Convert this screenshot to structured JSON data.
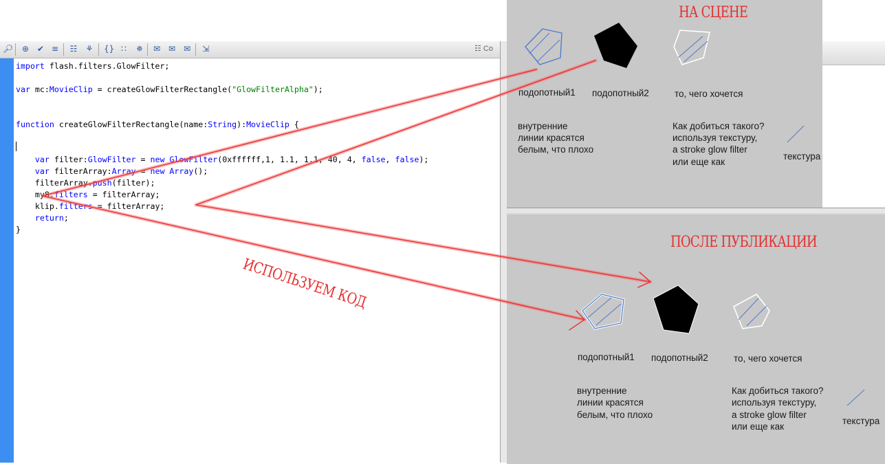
{
  "toolbar": {
    "right_label": "Co",
    "icons": [
      "find-icon",
      "target-icon",
      "check-syntax-icon",
      "auto-format-icon",
      "code-hint-icon",
      "debug-icon",
      "collapse-icon",
      "expand-icon",
      "collapse-all-icon",
      "comment-icon",
      "block-comment-icon",
      "uncomment-icon",
      "script-assist-icon"
    ]
  },
  "code": {
    "lines": [
      {
        "row": 0,
        "parts": [
          {
            "t": "import",
            "c": "kw"
          },
          {
            "t": " flash.filters.GlowFilter;",
            "c": ""
          }
        ]
      },
      {
        "row": 2,
        "parts": [
          {
            "t": "var",
            "c": "kw"
          },
          {
            "t": " mc:",
            "c": ""
          },
          {
            "t": "MovieClip",
            "c": "ty"
          },
          {
            "t": " = createGlowFilterRectangle(",
            "c": ""
          },
          {
            "t": "\"GlowFilterAlpha\"",
            "c": "str"
          },
          {
            "t": ");",
            "c": ""
          }
        ]
      },
      {
        "row": 5,
        "parts": [
          {
            "t": "function",
            "c": "kw"
          },
          {
            "t": " createGlowFilterRectangle(name:",
            "c": ""
          },
          {
            "t": "String",
            "c": "ty"
          },
          {
            "t": "):",
            "c": ""
          },
          {
            "t": "MovieClip",
            "c": "ty"
          },
          {
            "t": " {",
            "c": ""
          }
        ]
      },
      {
        "row": 8,
        "parts": [
          {
            "t": "    ",
            "c": ""
          },
          {
            "t": "var",
            "c": "kw"
          },
          {
            "t": " filter:",
            "c": ""
          },
          {
            "t": "GlowFilter",
            "c": "ty"
          },
          {
            "t": " = ",
            "c": ""
          },
          {
            "t": "new",
            "c": "kw"
          },
          {
            "t": " ",
            "c": ""
          },
          {
            "t": "GlowFilter",
            "c": "ty"
          },
          {
            "t": "(0xffffff,1, 1.1, 1.1, 40, 4, ",
            "c": ""
          },
          {
            "t": "false",
            "c": "kw"
          },
          {
            "t": ", ",
            "c": ""
          },
          {
            "t": "false",
            "c": "kw"
          },
          {
            "t": ");",
            "c": ""
          }
        ]
      },
      {
        "row": 9,
        "parts": [
          {
            "t": "    ",
            "c": ""
          },
          {
            "t": "var",
            "c": "kw"
          },
          {
            "t": " filterArray:",
            "c": ""
          },
          {
            "t": "Array",
            "c": "ty"
          },
          {
            "t": " = ",
            "c": ""
          },
          {
            "t": "new",
            "c": "kw"
          },
          {
            "t": " ",
            "c": ""
          },
          {
            "t": "Array",
            "c": "ty"
          },
          {
            "t": "();",
            "c": ""
          }
        ]
      },
      {
        "row": 10,
        "parts": [
          {
            "t": "    filterArray.",
            "c": ""
          },
          {
            "t": "push",
            "c": "kw"
          },
          {
            "t": "(filter);",
            "c": ""
          }
        ]
      },
      {
        "row": 11,
        "parts": [
          {
            "t": "    my8.",
            "c": ""
          },
          {
            "t": "filters",
            "c": "kw"
          },
          {
            "t": " = filterArray;",
            "c": ""
          }
        ]
      },
      {
        "row": 12,
        "parts": [
          {
            "t": "    klip.",
            "c": ""
          },
          {
            "t": "filters",
            "c": "kw"
          },
          {
            "t": " = filterArray;",
            "c": ""
          }
        ]
      },
      {
        "row": 13,
        "parts": [
          {
            "t": "    ",
            "c": ""
          },
          {
            "t": "return",
            "c": "kw"
          },
          {
            "t": ";",
            "c": ""
          }
        ]
      },
      {
        "row": 14,
        "parts": [
          {
            "t": "}",
            "c": ""
          }
        ]
      }
    ]
  },
  "annotation": {
    "text": "ИСПОЛЬЗУЕМ КОД",
    "color": "#e53030"
  },
  "stage_top": {
    "heading": "НА СЦЕНЕ",
    "subject1": "подопотный1",
    "subject2": "подопотный2",
    "wanted": "то, чего хочется",
    "note_left": [
      "внутренние",
      "линии красятся",
      "белым, что  плохо"
    ],
    "note_right": [
      "Как добиться такого?",
      "используя текстуру,",
      "a stroke glow filter",
      "или еще как"
    ],
    "texture": "текстура"
  },
  "stage_bottom": {
    "heading": "ПОСЛЕ ПУБЛИКАЦИИ",
    "subject1": "подопотный1",
    "subject2": "подопотный2",
    "wanted": "то, чего хочется",
    "note_left": [
      "внутренние",
      "линии красятся",
      "белым, что  плохо"
    ],
    "note_right": [
      "Как добиться такого?",
      "используя текстуру,",
      "a stroke glow filter",
      "или еще как"
    ],
    "texture": "текстура"
  },
  "colors": {
    "accent_red": "#e53030",
    "gutter": "#3d8ef3",
    "keyword": "#0000ff",
    "string": "#008000",
    "panel": "#c8c8c8"
  }
}
